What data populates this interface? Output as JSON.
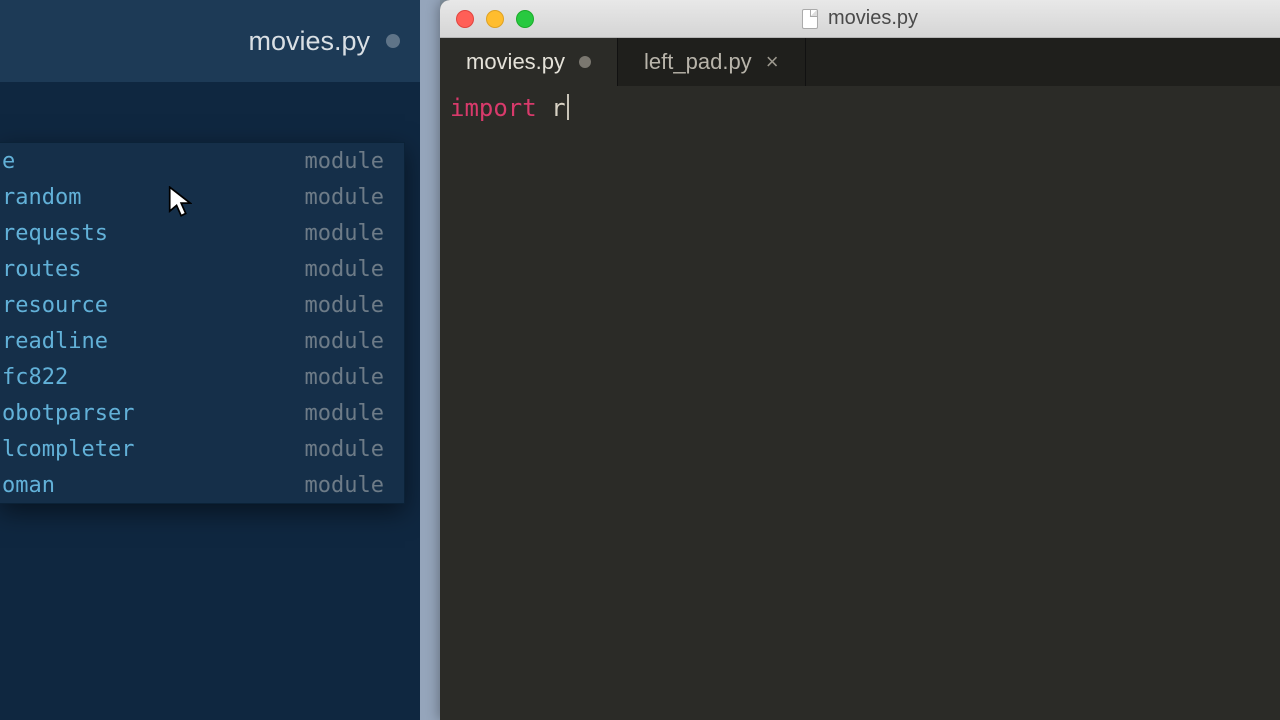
{
  "left": {
    "tab_title": "movies.py",
    "autocomplete": [
      {
        "name": "e",
        "kind": "module"
      },
      {
        "name": "random",
        "kind": "module"
      },
      {
        "name": "requests",
        "kind": "module"
      },
      {
        "name": "routes",
        "kind": "module"
      },
      {
        "name": "resource",
        "kind": "module"
      },
      {
        "name": "readline",
        "kind": "module"
      },
      {
        "name": "fc822",
        "kind": "module"
      },
      {
        "name": "obotparser",
        "kind": "module"
      },
      {
        "name": "lcompleter",
        "kind": "module"
      },
      {
        "name": "oman",
        "kind": "module"
      }
    ]
  },
  "right": {
    "window_title": "movies.py",
    "tabs": [
      {
        "label": "movies.py",
        "dirty": true,
        "active": true
      },
      {
        "label": "left_pad.py",
        "dirty": false,
        "active": false
      }
    ],
    "code": {
      "keyword": "import",
      "rest": " r"
    }
  }
}
